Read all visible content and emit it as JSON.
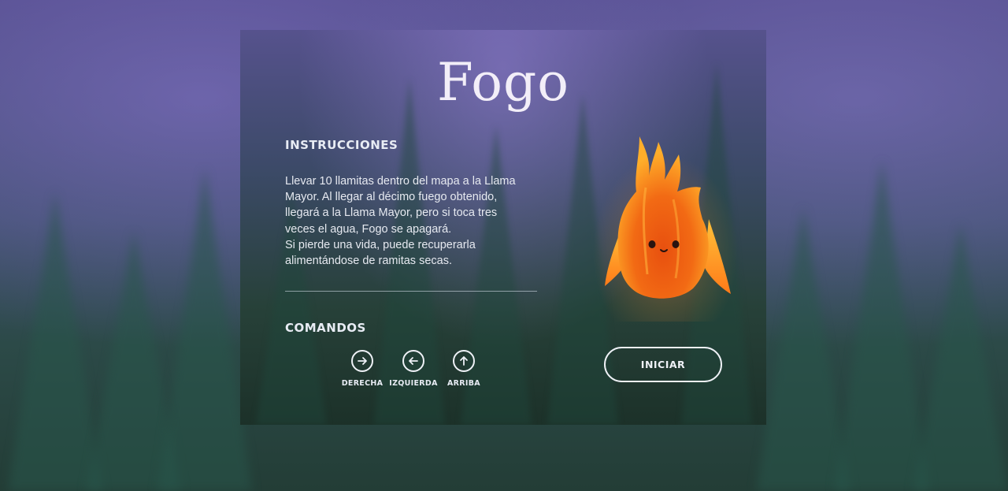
{
  "game": {
    "title": "Fogo"
  },
  "instructions": {
    "heading": "INSTRUCCIONES",
    "lines": [
      "Llevar 10 llamitas dentro del mapa a la Llama",
      "Mayor. Al llegar al décimo fuego obtenido,",
      "llegará a la Llama Mayor, pero si toca tres",
      "veces el agua, Fogo se apagará.",
      "Si pierde una vida, puede recuperarla",
      "alimentándose de ramitas secas."
    ]
  },
  "commands": {
    "heading": "COMANDOS",
    "items": [
      {
        "label": "DERECHA",
        "icon": "arrow-right-icon"
      },
      {
        "label": "IZQUIERDA",
        "icon": "arrow-left-icon"
      },
      {
        "label": "ARRIBA",
        "icon": "arrow-up-icon"
      }
    ]
  },
  "start_button": {
    "label": "INICIAR"
  },
  "colors": {
    "text": "#eef1f6",
    "flame_outer": "#ff9a1f",
    "flame_inner": "#e8500f",
    "panel_top": "#56528d",
    "panel_bottom": "#1c3129"
  }
}
